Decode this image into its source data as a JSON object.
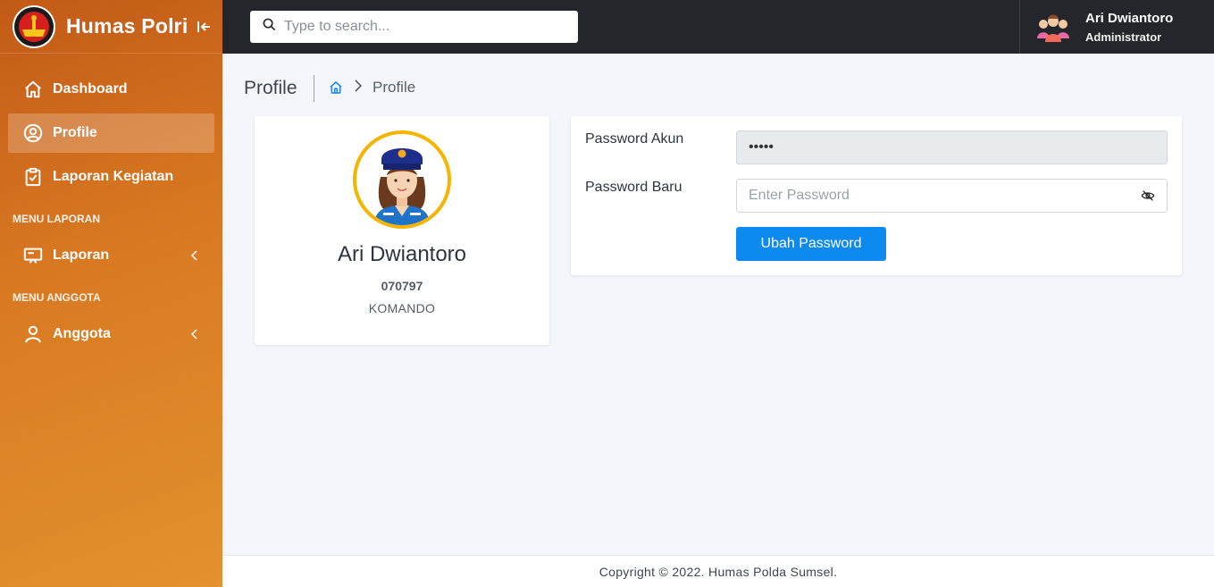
{
  "app": {
    "title": "Humas Polri"
  },
  "sidebar": {
    "items": [
      {
        "label": "Dashboard",
        "icon": "home-icon"
      },
      {
        "label": "Profile",
        "icon": "user-circle-icon",
        "active": true
      },
      {
        "label": "Laporan Kegiatan",
        "icon": "clipboard-check-icon"
      }
    ],
    "section_laporan": "MENU LAPORAN",
    "laporan": {
      "label": "Laporan",
      "icon": "presentation-icon"
    },
    "section_anggota": "MENU ANGGOTA",
    "anggota": {
      "label": "Anggota",
      "icon": "user-icon"
    }
  },
  "header": {
    "search_placeholder": "Type to search...",
    "user_name": "Ari Dwiantoro",
    "user_role": "Administrator"
  },
  "page": {
    "title": "Profile",
    "breadcrumb_current": "Profile"
  },
  "profile": {
    "name": "Ari Dwiantoro",
    "nrp": "070797",
    "unit": "KOMANDO"
  },
  "password_form": {
    "current_label": "Password Akun",
    "current_value": "•••••",
    "new_label": "Password Baru",
    "new_placeholder": "Enter Password",
    "submit_label": "Ubah Password"
  },
  "footer": {
    "text": "Copyright © 2022. Humas Polda Sumsel."
  },
  "colors": {
    "sidebar_start": "#c25a17",
    "sidebar_end": "#e2922e",
    "topbar": "#24262b",
    "primary_button": "#0d8af0",
    "avatar_ring": "#f4b400"
  }
}
